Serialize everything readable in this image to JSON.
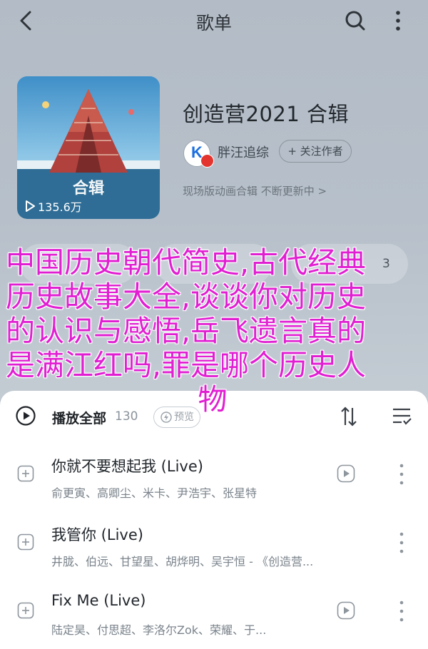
{
  "header": {
    "title": "歌单",
    "back_icon": "chevron-left-icon",
    "search_icon": "search-icon",
    "more_icon": "more-vertical-icon"
  },
  "album": {
    "cover_text": "合辑",
    "play_count": "135.6万",
    "title": "创造营2021 合辑",
    "creator": "胖汪追综",
    "follow_label": "+ 关注作者",
    "description": "现场版动画合辑 不断更新中 >"
  },
  "actions": {
    "count_right": "3"
  },
  "overlay": {
    "line1": "中国历史朝代简史,古代经典",
    "line2": "历史故事大全,谈谈你对历史",
    "line3": "的认识与感悟,岳飞遗言真的",
    "line4": "是满江红吗,罪是哪个历史人",
    "line5": "物",
    "color": "#e11fd2"
  },
  "list": {
    "play_all_label": "播放全部",
    "play_all_count": "130",
    "preview_label": "预览",
    "songs": [
      {
        "title": "你就不要想起我 (Live)",
        "artists": "俞更寅、高卿尘、米卡、尹浩宇、张星特"
      },
      {
        "title": "我管你 (Live)",
        "artists": "井胧、伯远、甘望星、胡烨明、吴宇恒 - 《创造营..."
      },
      {
        "title": "Fix Me (Live)",
        "artists": "陆定昊、付思超、李洛尔Zok、荣耀、于..."
      }
    ]
  }
}
